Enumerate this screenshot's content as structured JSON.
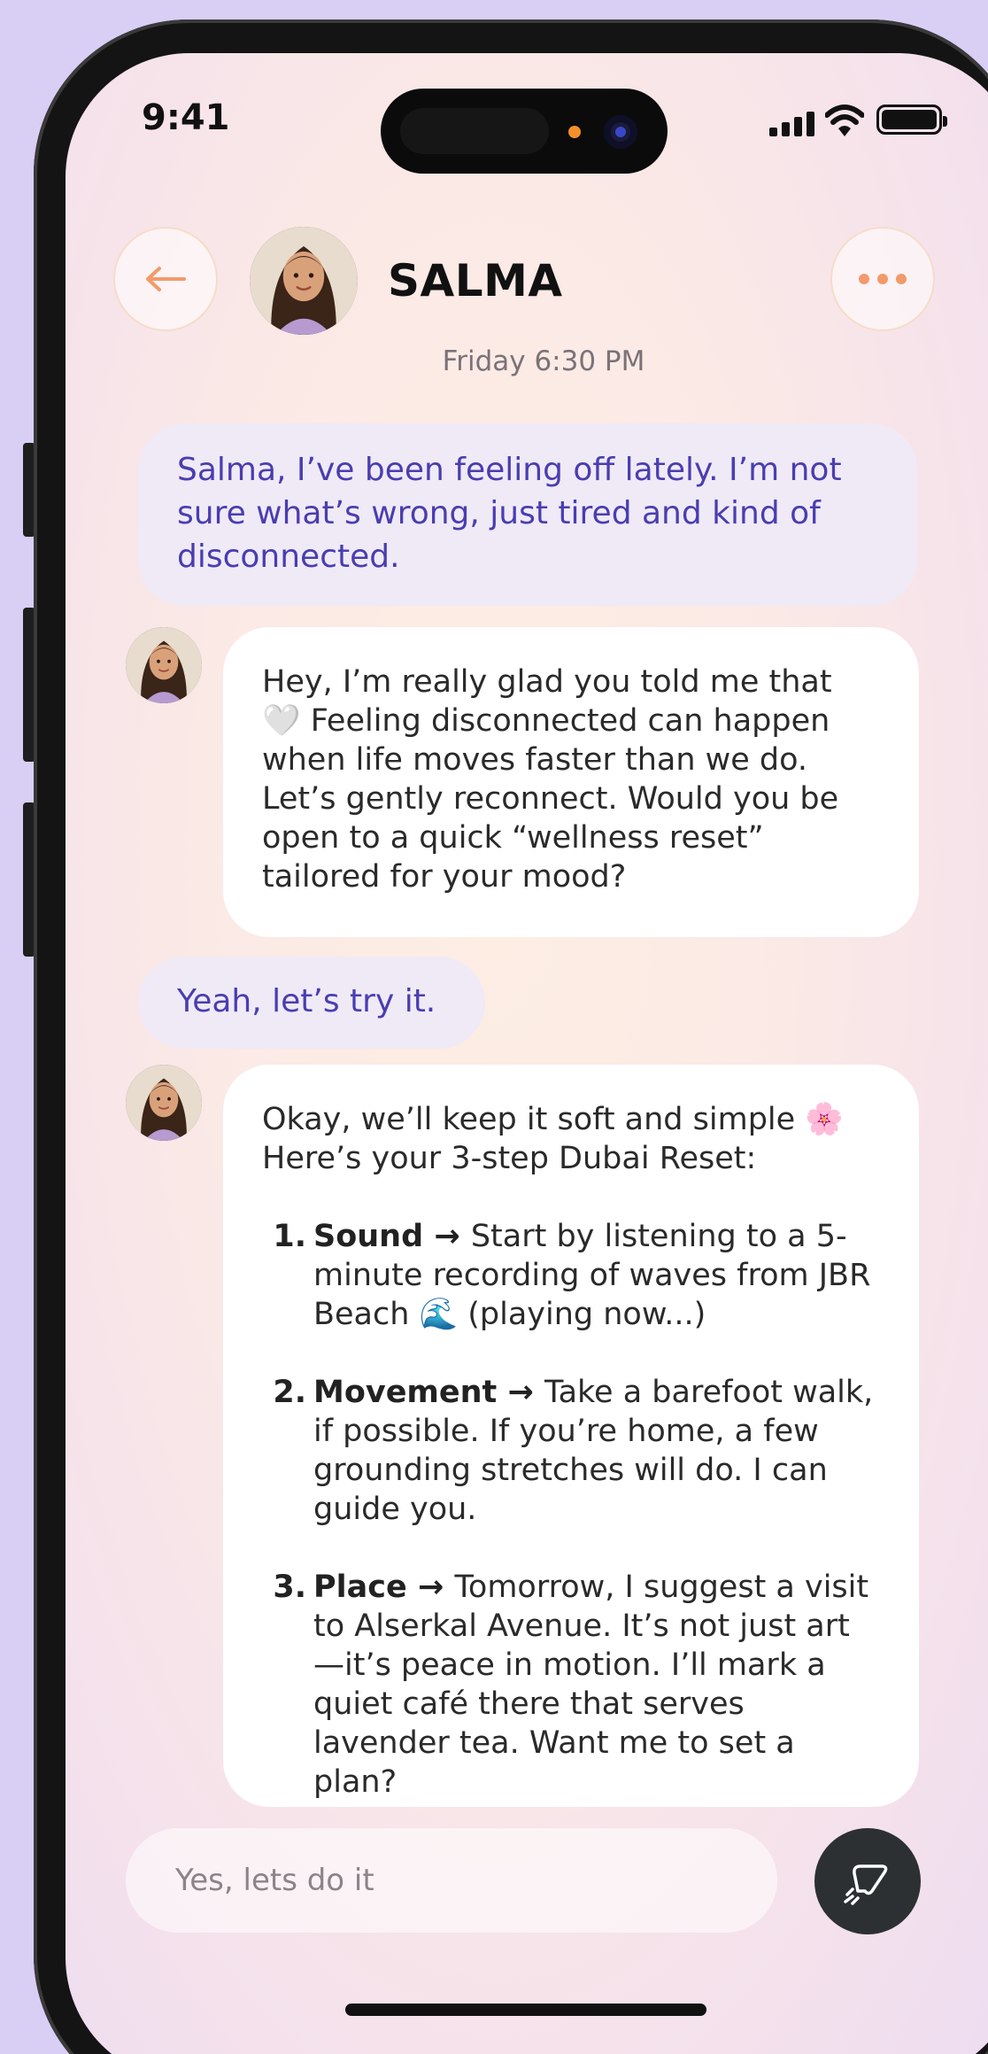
{
  "status_bar": {
    "time": "9:41"
  },
  "header": {
    "contact_name": "SALMA",
    "timestamp": "Friday 6:30 PM"
  },
  "icons": {
    "back": "arrow-left-icon",
    "more": "more-horizontal-icon",
    "send": "send-icon",
    "accent_color": "#f29a6a",
    "user_text_color": "#4a3db0"
  },
  "messages": {
    "user_1": "Salma, I’ve been feeling off lately. I’m not sure what’s wrong, just tired and kind of disconnected.",
    "ai_1": "Hey, I’m really glad you told me that 🤍 Feeling disconnected can happen when life moves faster than we do. Let’s gently reconnect. Would you be open to a quick “wellness reset” tailored for your mood?",
    "user_2": "Yeah, let’s try it.",
    "ai_2": {
      "intro_line_1": "Okay, we’ll keep it soft and simple 🌸",
      "intro_line_2": "Here’s your 3-step Dubai Reset:",
      "steps": [
        {
          "num": "1.",
          "title": "Sound",
          "arrow": " → ",
          "text": "Start by listening to a 5-minute recording of waves from JBR Beach 🌊 (playing now...)"
        },
        {
          "num": "2.",
          "title": "Movement",
          "arrow": " → ",
          "text": "Take a barefoot walk, if possible. If you’re home, a few grounding stretches will do. I can guide you."
        },
        {
          "num": "3.",
          "title": "Place",
          "arrow": " → ",
          "text": "Tomorrow, I suggest a visit to Alserkal Avenue. It’s not just art—it’s peace in motion. I’ll mark a quiet café there that serves lavender tea. Want me to set a plan?"
        }
      ]
    }
  },
  "composer": {
    "placeholder": "Yes, lets do it"
  }
}
